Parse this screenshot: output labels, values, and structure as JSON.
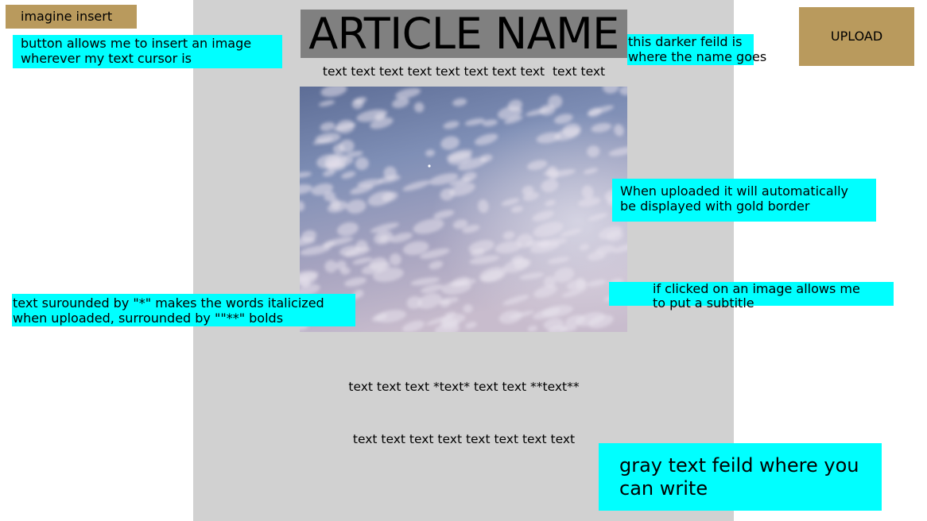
{
  "toolbar": {
    "insert_label": "imagine insert",
    "upload_label": "UPLOAD"
  },
  "article": {
    "title": "ARTICLE NAME",
    "first_line": "text text text text text text text text  text text",
    "body_line_1": "text text text *text* text text **text**",
    "body_line_2": "text text text text text text text text"
  },
  "notes": {
    "insert": "button allows me to insert an image\nwherever my text cursor is",
    "title": "this darker feild is\nwhere the name goes",
    "upload": "When uploaded it will automatically\nbe displayed with gold border",
    "subtitle": "if clicked on an image allows me\nto put a subtitle",
    "format": "text surounded by \"*\" makes the words italicized\nwhen uploaded, surrounded by \"\"**\" bolds",
    "field": "gray text feild where you\ncan write"
  },
  "colors": {
    "panel": "#d1d1d1",
    "title_field": "#808080",
    "gold": "#b99a5d",
    "note": "#00ffff"
  },
  "icons": {
    "image": "sky-clouds-photo"
  }
}
